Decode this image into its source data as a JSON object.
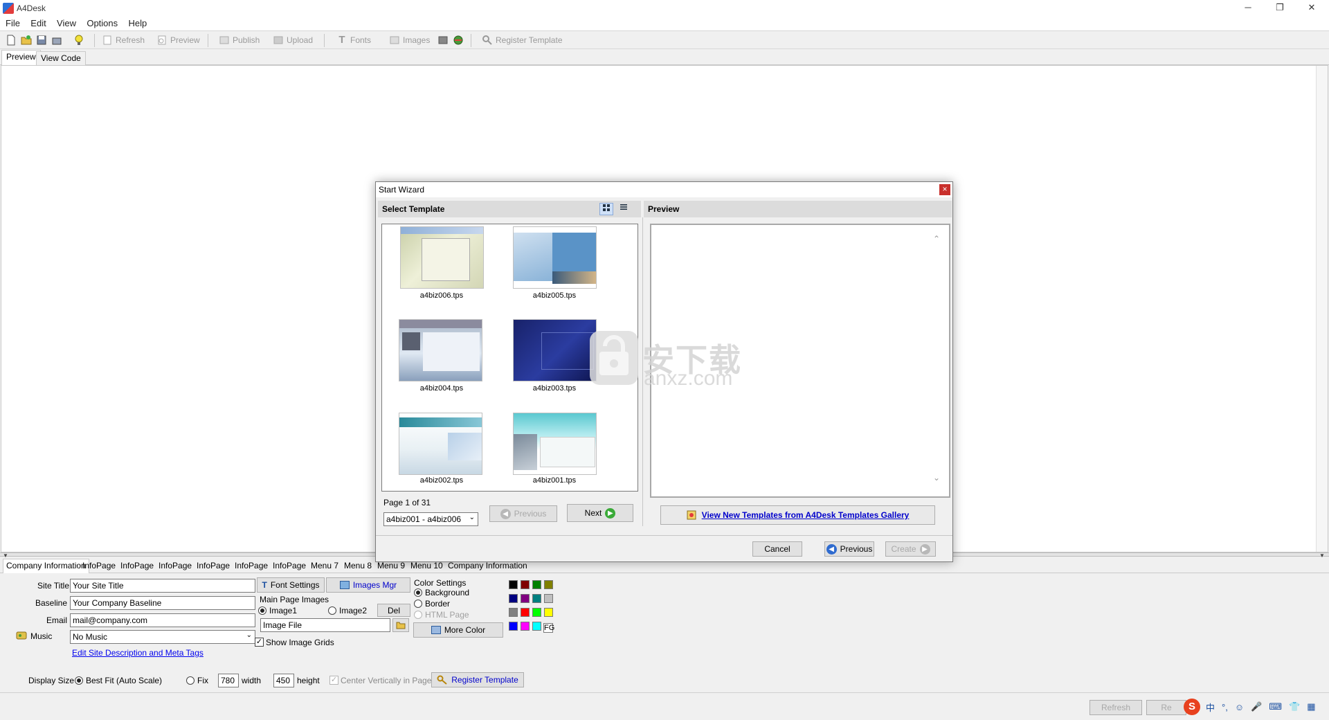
{
  "window": {
    "title": "A4Desk",
    "controls": [
      "─",
      "❐",
      "✕"
    ]
  },
  "menu": {
    "items": [
      "File",
      "Edit",
      "View",
      "Options",
      "Help"
    ]
  },
  "toolbar": {
    "refresh": "Refresh",
    "preview": "Preview",
    "publish": "Publish",
    "upload": "Upload",
    "fonts": "Fonts",
    "images": "Images",
    "register": "Register Template"
  },
  "view_tabs": [
    "Preview",
    "View Code"
  ],
  "bottom_tabs": [
    "Company Information",
    "InfoPage",
    "InfoPage",
    "InfoPage",
    "InfoPage",
    "InfoPage",
    "InfoPage",
    "Menu 7",
    "Menu 8",
    "Menu 9",
    "Menu 10",
    "Company Information"
  ],
  "form": {
    "site_title_label": "Site Title",
    "site_title_value": "Your Site Title",
    "baseline_label": "Baseline",
    "baseline_value": "Your Company Baseline",
    "email_label": "Email",
    "email_value": "mail@company.com",
    "music_label": "Music",
    "music_value": "No Music",
    "edit_meta_link": "Edit Site Description and Meta Tags",
    "font_settings": "Font Settings",
    "images_mgr": "Images Mgr",
    "main_images_label": "Main Page Images",
    "image1": "Image1",
    "image2": "Image2",
    "del": "Del",
    "image_file": "Image File",
    "show_grids": "Show Image Grids",
    "color_settings": "Color Settings",
    "background": "Background",
    "border": "Border",
    "html_page": "HTML Page",
    "more_color": "More Color",
    "fg": "FG",
    "display_size": "Display Size",
    "best_fit": "Best Fit (Auto Scale)",
    "fix": "Fix",
    "width_value": "780",
    "width_label": "width",
    "height_value": "450",
    "height_label": "height",
    "center_vert": "Center Vertically in Page",
    "register_template": "Register Template"
  },
  "swatches": [
    "#000000",
    "#800000",
    "#008000",
    "#808000",
    "#000080",
    "#800080",
    "#008080",
    "#c0c0c0",
    "#808080",
    "#ff0000",
    "#00ff00",
    "#ffff00",
    "#0000ff",
    "#ff00ff",
    "#00ffff"
  ],
  "status": {
    "refresh": "Refresh",
    "trailing": "Re",
    "ime": [
      "中",
      "°,",
      "☺",
      "🎤",
      "⌨",
      "👕",
      "▦"
    ]
  },
  "dialog": {
    "title": "Start Wizard",
    "close": "×",
    "select_template": "Select Template",
    "preview": "Preview",
    "templates": [
      "a4biz006.tps",
      "a4biz005.tps",
      "a4biz004.tps",
      "a4biz003.tps",
      "a4biz002.tps",
      "a4biz001.tps"
    ],
    "page_info": "Page 1 of 31",
    "range_value": "a4biz001 - a4biz006",
    "previous": "Previous",
    "next": "Next",
    "gallery_link": "View New Templates from A4Desk Templates Gallery",
    "cancel": "Cancel",
    "create": "Create"
  },
  "watermark": {
    "cn": "安下载",
    "en": "anxz.com"
  }
}
